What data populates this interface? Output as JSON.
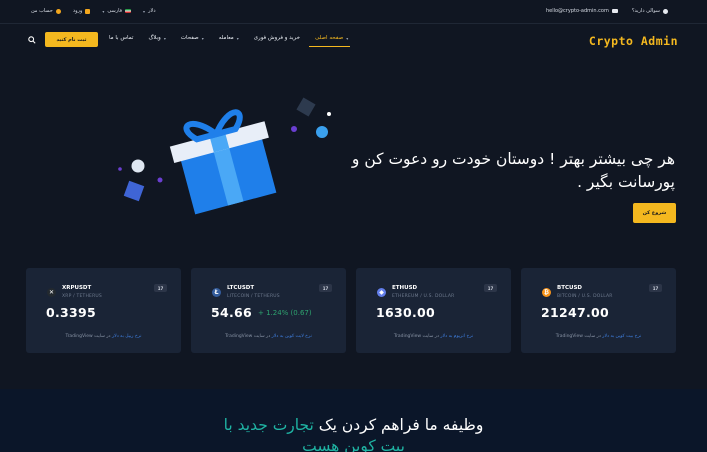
{
  "topbar": {
    "account_label": "حساب من",
    "login_label": "ورود",
    "language_label": "فارسی",
    "currency_label": "دلار",
    "email": "hello@crypto-admin.com",
    "question_label": "سوالی دارید؟"
  },
  "nav": {
    "logo": "Crypto Admin",
    "menu": [
      {
        "label": "صفحه اصلی",
        "active": true,
        "dropdown": true
      },
      {
        "label": "خرید و فروش فوری",
        "active": false,
        "dropdown": false
      },
      {
        "label": "معامله",
        "active": false,
        "dropdown": true
      },
      {
        "label": "صفحات",
        "active": false,
        "dropdown": true
      },
      {
        "label": "وبلاگ",
        "active": false,
        "dropdown": true
      },
      {
        "label": "تماس با ما",
        "active": false,
        "dropdown": false
      }
    ],
    "signup_button": "ثبت نام کنید",
    "search_icon": "search-icon"
  },
  "hero": {
    "title": "هر چی بیشتر بهتر ! دوستان خودت رو دعوت کن و پورسانت بگیر .",
    "cta": "شروع کن",
    "illustration": "gift-icon"
  },
  "tickers": [
    {
      "symbol": "XRPUSDT",
      "pair": "XRP / TETHERUS",
      "price": "0.3395",
      "change": "",
      "icon_color": "#23292f",
      "icon_glyph": "✕",
      "footer_source": "TradingView",
      "footer_text": "در سایت",
      "footer_link": "نرخ ریپل به دلار"
    },
    {
      "symbol": "LTCUSDT",
      "pair": "LITECOIN / TETHERUS",
      "price": "54.66",
      "change": "+ 1.24% (0.67)",
      "icon_color": "#345d9d",
      "icon_glyph": "Ł",
      "footer_source": "TradingView",
      "footer_text": "در سایت",
      "footer_link": "نرخ لایت کوین به دلار"
    },
    {
      "symbol": "ETHUSD",
      "pair": "ETHEREUM / U.S. DOLLAR",
      "price": "1630.00",
      "change": "",
      "icon_color": "#627eea",
      "icon_glyph": "◆",
      "footer_source": "TradingView",
      "footer_text": "در سایت",
      "footer_link": "نرخ اتریوم به دلار"
    },
    {
      "symbol": "BTCUSD",
      "pair": "BITCOIN / U.S. DOLLAR",
      "price": "21247.00",
      "change": "",
      "icon_color": "#f7931a",
      "icon_glyph": "₿",
      "footer_source": "TradingView",
      "footer_text": "در سایت",
      "footer_link": "نرخ بیت کوین به دلار"
    }
  ],
  "tv_badge": "17",
  "mission": {
    "prefix": "وظیفه ما فراهم کردن یک ",
    "highlight": "تجارت جدید با",
    "line2": "بیت کوین هست"
  },
  "colors": {
    "background": "#101622",
    "accent": "#f4b81f",
    "card": "#1a2436",
    "positive": "#2ea36f",
    "teal": "#1fb3a3"
  }
}
